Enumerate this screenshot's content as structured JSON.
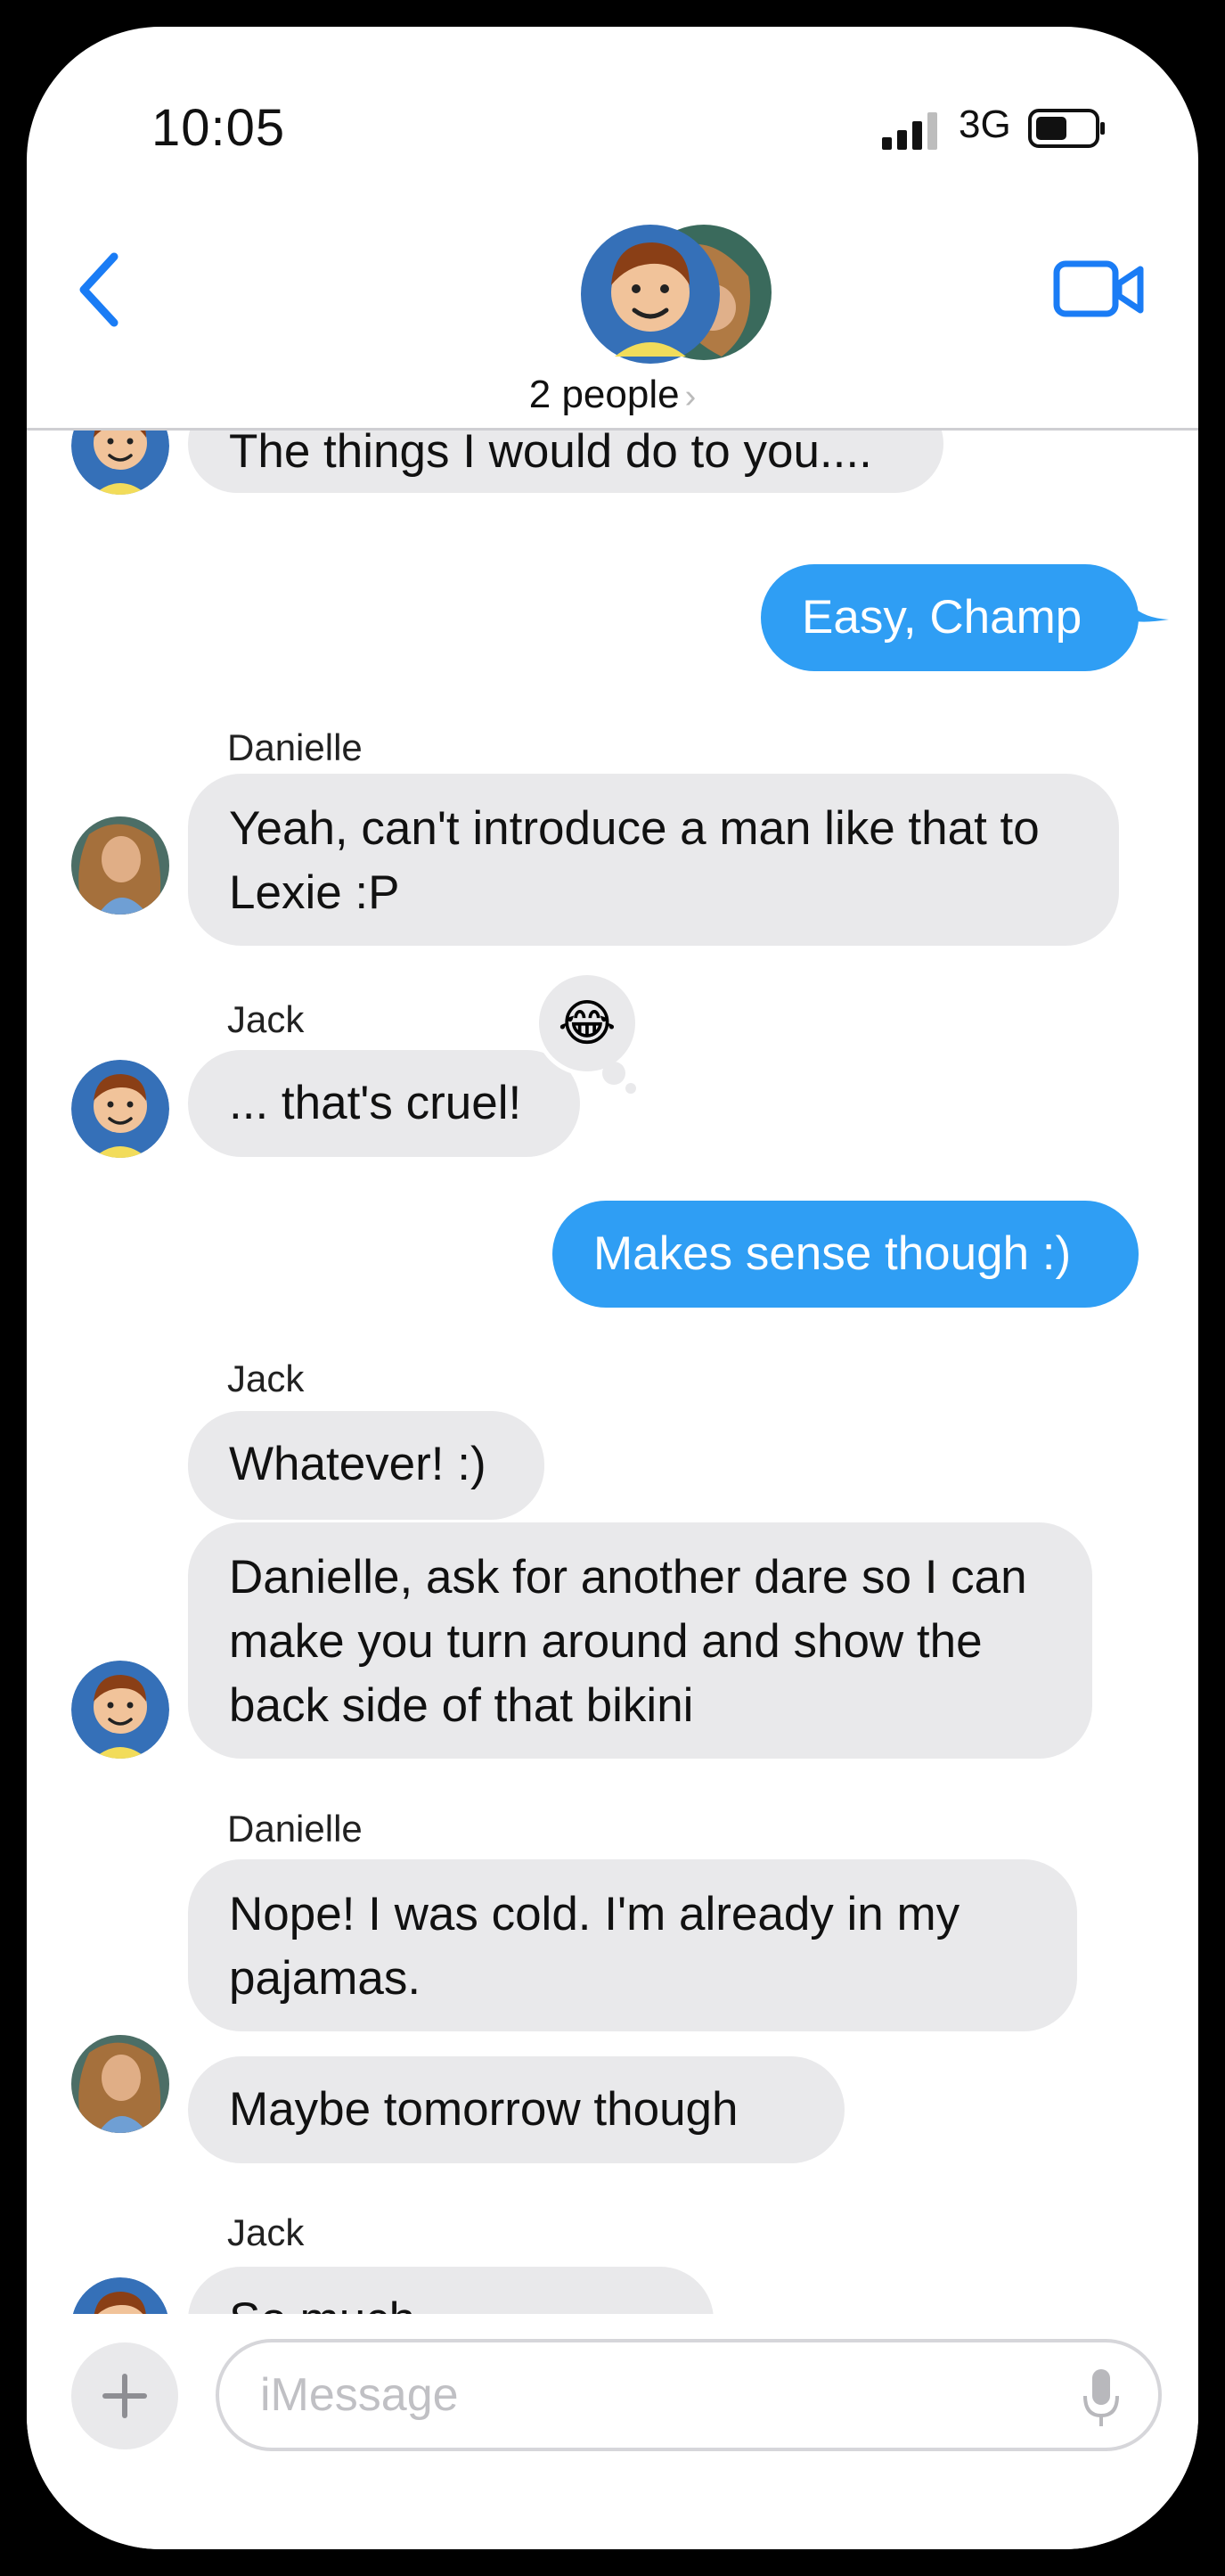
{
  "status": {
    "time": "10:05",
    "network": "3G"
  },
  "header": {
    "participants": "2 people"
  },
  "messages": [
    {
      "text": "The things I would do to you...."
    },
    {
      "text": "Easy, Champ"
    },
    {
      "sender": "Danielle",
      "text": "Yeah, can't introduce a man like that to",
      "text2": "Lexie :P"
    },
    {
      "sender": "Jack",
      "text": "... that's cruel!",
      "reaction": "😂"
    },
    {
      "text": "Makes sense though :)"
    },
    {
      "sender": "Jack",
      "text": "Whatever! :)"
    },
    {
      "text": "Danielle, ask for another dare so I can",
      "text2": "make you turn around and show the",
      "text3": "back side of that bikini"
    },
    {
      "sender": "Danielle",
      "text": "Nope!  I was cold.  I'm already in my",
      "text2": "pajamas."
    },
    {
      "text": "Maybe tomorrow though"
    },
    {
      "sender": "Jack",
      "text": "So much appreciated"
    }
  ],
  "compose": {
    "placeholder": "iMessage"
  },
  "colors": {
    "accent": "#2f9ef4",
    "incoming": "#e9e9eb",
    "icon_blue": "#1a7cf5"
  },
  "icons": [
    "back-chevron-icon",
    "video-camera-icon",
    "plus-icon",
    "microphone-icon",
    "signal-icon",
    "battery-icon"
  ]
}
